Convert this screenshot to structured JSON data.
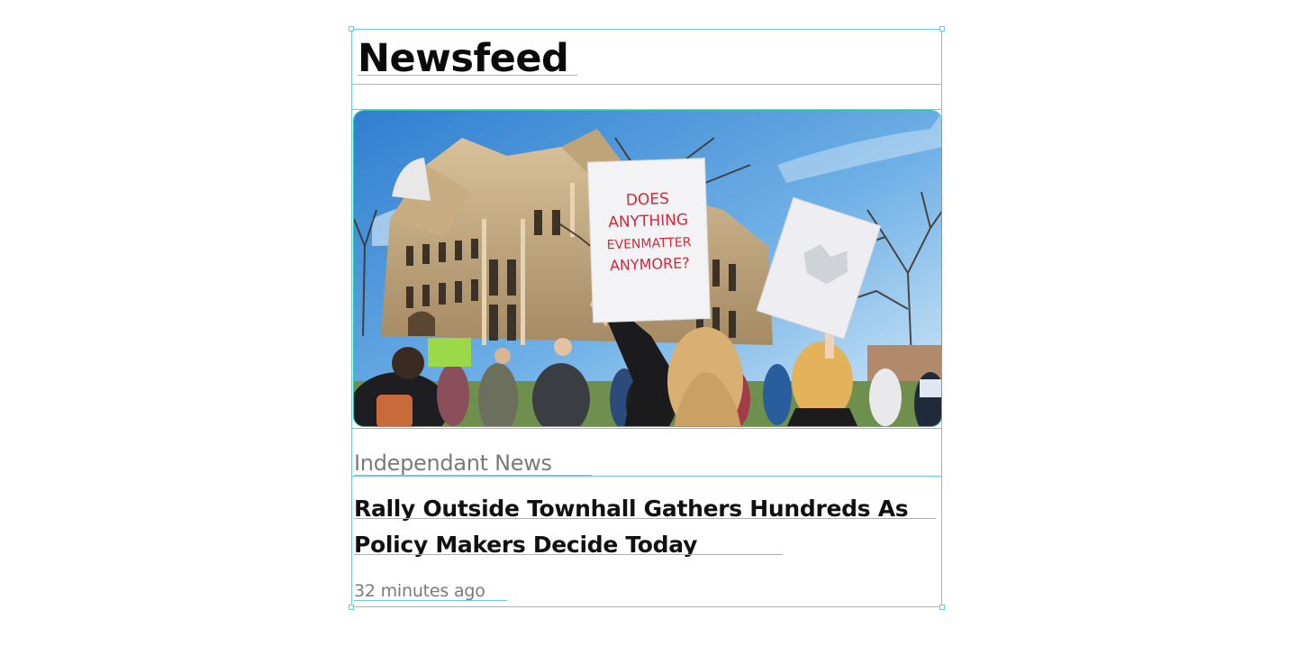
{
  "feed": {
    "title": "Newsfeed"
  },
  "article": {
    "image": {
      "sign_text": [
        "DOES",
        "ANYTHING",
        "EVENMATTER",
        "ANYMORE?"
      ]
    },
    "source": "Independant News",
    "headline": "Rally Outside Townhall Gathers Hundreds As Policy Makers Decide Today",
    "timestamp": "32 minutes ago"
  },
  "colors": {
    "selection": "#6cc7ee",
    "image_border": "#2ec4a8",
    "sign_text": "#d4283a",
    "meta_text": "#7a7a7a",
    "headline_text": "#111111"
  }
}
